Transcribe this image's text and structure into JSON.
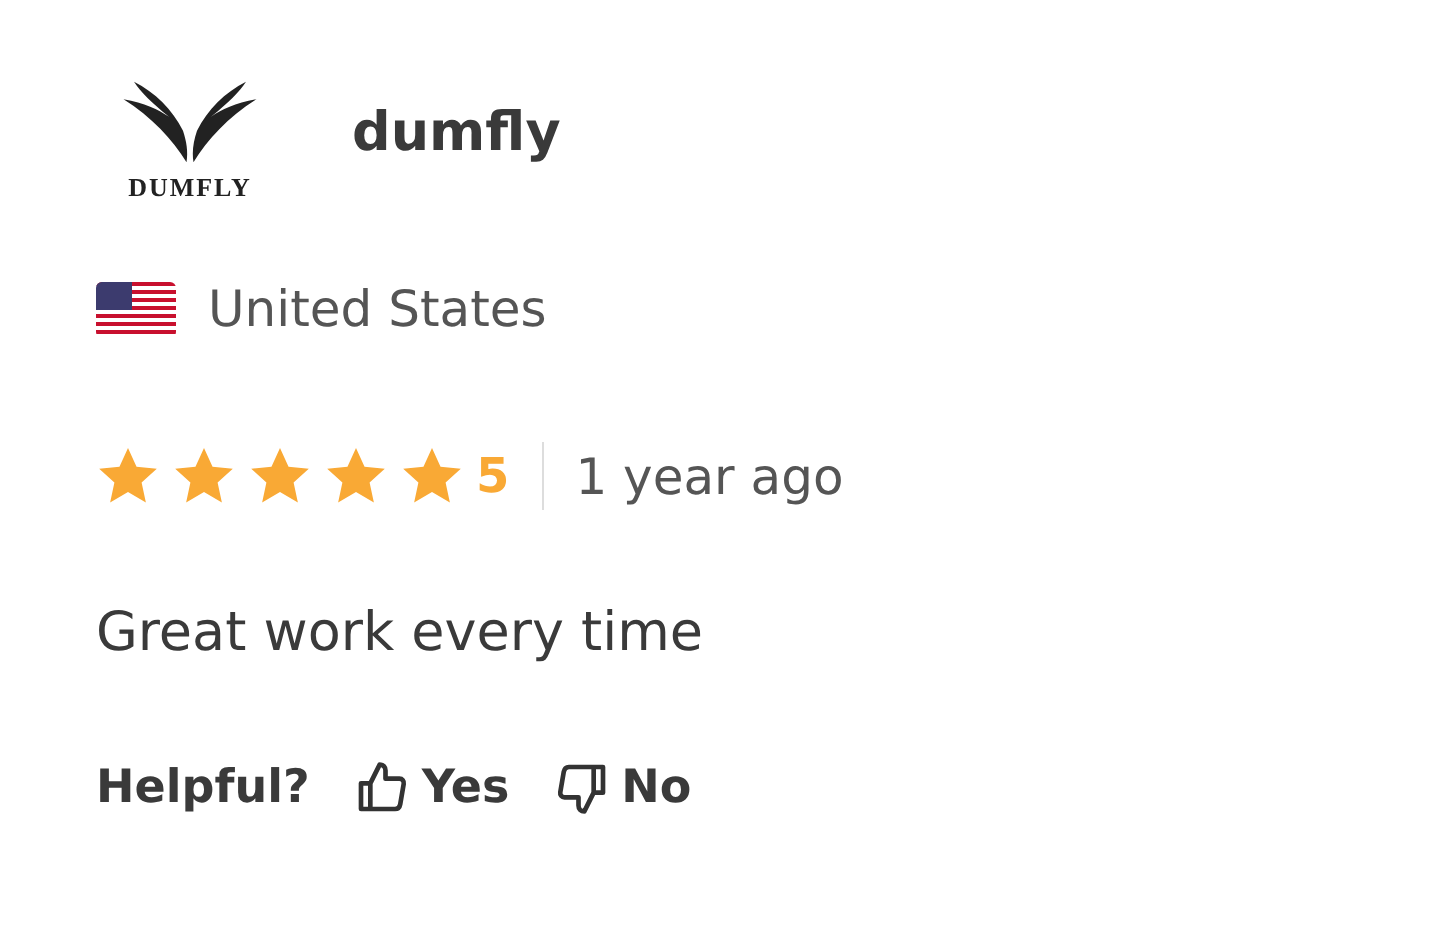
{
  "reviewer": {
    "logo_text": "DUMFLY",
    "name": "dumfly",
    "country": "United States"
  },
  "rating": {
    "stars": 5,
    "score": "5",
    "time": "1 year ago"
  },
  "body": "Great work every time",
  "feedback": {
    "label": "Helpful?",
    "yes": "Yes",
    "no": "No"
  }
}
